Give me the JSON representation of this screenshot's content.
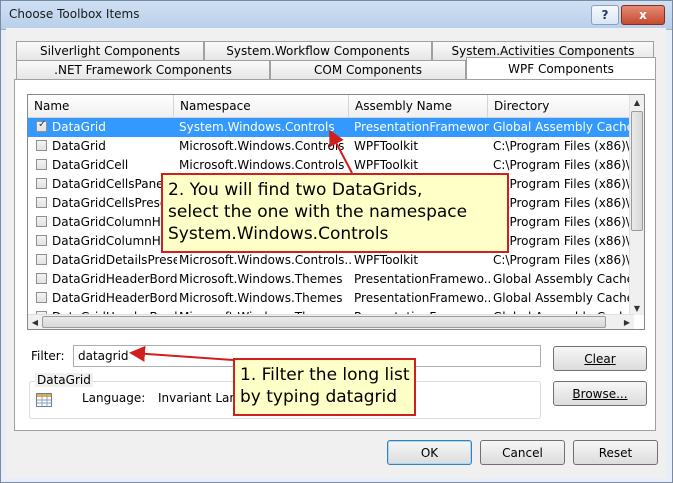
{
  "window": {
    "title": "Choose Toolbox Items",
    "help_label": "?",
    "close_label": "x"
  },
  "tabs": {
    "row1": [
      "Silverlight Components",
      "System.Workflow Components",
      "System.Activities Components"
    ],
    "row2": [
      ".NET Framework Components",
      "COM Components",
      "WPF Components"
    ],
    "active": "WPF Components"
  },
  "grid": {
    "columns": [
      "Name",
      "Namespace",
      "Assembly Name",
      "Directory"
    ],
    "rows": [
      {
        "checked": true,
        "selected": true,
        "name": "DataGrid",
        "namespace": "System.Windows.Controls",
        "assembly": "PresentationFramework",
        "directory": "Global Assembly Cache"
      },
      {
        "checked": false,
        "selected": false,
        "name": "DataGrid",
        "namespace": "Microsoft.Windows.Controls",
        "assembly": "WPFToolkit",
        "directory": "C:\\Program Files (x86)\\..."
      },
      {
        "checked": false,
        "selected": false,
        "name": "DataGridCell",
        "namespace": "Microsoft.Windows.Controls",
        "assembly": "WPFToolkit",
        "directory": "C:\\Program Files (x86)\\..."
      },
      {
        "checked": false,
        "selected": false,
        "name": "DataGridCellsPanel",
        "namespace": "",
        "assembly": "",
        "directory": "C:\\Program Files (x86)\\..."
      },
      {
        "checked": false,
        "selected": false,
        "name": "DataGridCellsPresent",
        "namespace": "",
        "assembly": "",
        "directory": "C:\\Program Files (x86)\\..."
      },
      {
        "checked": false,
        "selected": false,
        "name": "DataGridColumnHea",
        "namespace": "",
        "assembly": "",
        "directory": "C:\\Program Files (x86)\\..."
      },
      {
        "checked": false,
        "selected": false,
        "name": "DataGridColumnHea",
        "namespace": "",
        "assembly": "",
        "directory": "C:\\Program Files (x86)\\..."
      },
      {
        "checked": false,
        "selected": false,
        "name": "DataGridDetailsPrese...",
        "namespace": "Microsoft.Windows.Controls...",
        "assembly": "WPFToolkit",
        "directory": "C:\\Program Files (x86)\\..."
      },
      {
        "checked": false,
        "selected": false,
        "name": "DataGridHeaderBorder",
        "namespace": "Microsoft.Windows.Themes",
        "assembly": "PresentationFramewo...",
        "directory": "Global Assembly Cache"
      },
      {
        "checked": false,
        "selected": false,
        "name": "DataGridHeaderBorder",
        "namespace": "Microsoft.Windows.Themes",
        "assembly": "PresentationFramewo...",
        "directory": "Global Assembly Cache"
      },
      {
        "checked": false,
        "selected": false,
        "name": "DataGridHeaderBorder",
        "namespace": "Microsoft.Windows.Themes",
        "assembly": "PresentationFramewo...",
        "directory": "Global Assembly Cache"
      }
    ]
  },
  "filter": {
    "label": "Filter:",
    "value": "datagrid",
    "clear_label": "Clear"
  },
  "details": {
    "group_title": "DataGrid",
    "language_label": "Language:",
    "language_value": "Invariant Lang",
    "browse_label": "Browse..."
  },
  "buttons": {
    "ok": "OK",
    "cancel": "Cancel",
    "reset": "Reset"
  },
  "callouts": {
    "top": [
      "2. You will find two DataGrids,",
      "select the one with the namespace",
      "System.Windows.Controls"
    ],
    "bottom": [
      "1. Filter the long list",
      "by typing datagrid"
    ]
  },
  "colors": {
    "callout_border": "#d01f1f",
    "callout_fill": "#ffffc8",
    "selection": "#3399ff"
  }
}
